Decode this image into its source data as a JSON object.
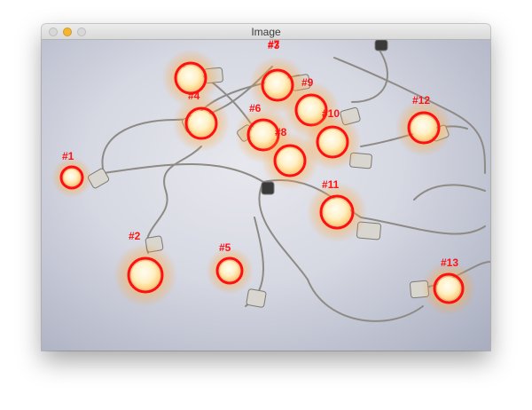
{
  "window": {
    "title": "Image"
  },
  "buttons": {
    "close": "close",
    "minimize": "minimize",
    "zoom": "zoom"
  },
  "colors": {
    "detection_ring": "#ff1010",
    "bulb_glow": "#ffb347",
    "bulb_core": "#fff6d8",
    "socket": "#d9d6cf"
  },
  "labels": [
    "#1",
    "#2",
    "#3",
    "#4",
    "#5",
    "#6",
    "#7",
    "#8",
    "#9",
    "#10",
    "#11",
    "#12",
    "#13"
  ]
}
